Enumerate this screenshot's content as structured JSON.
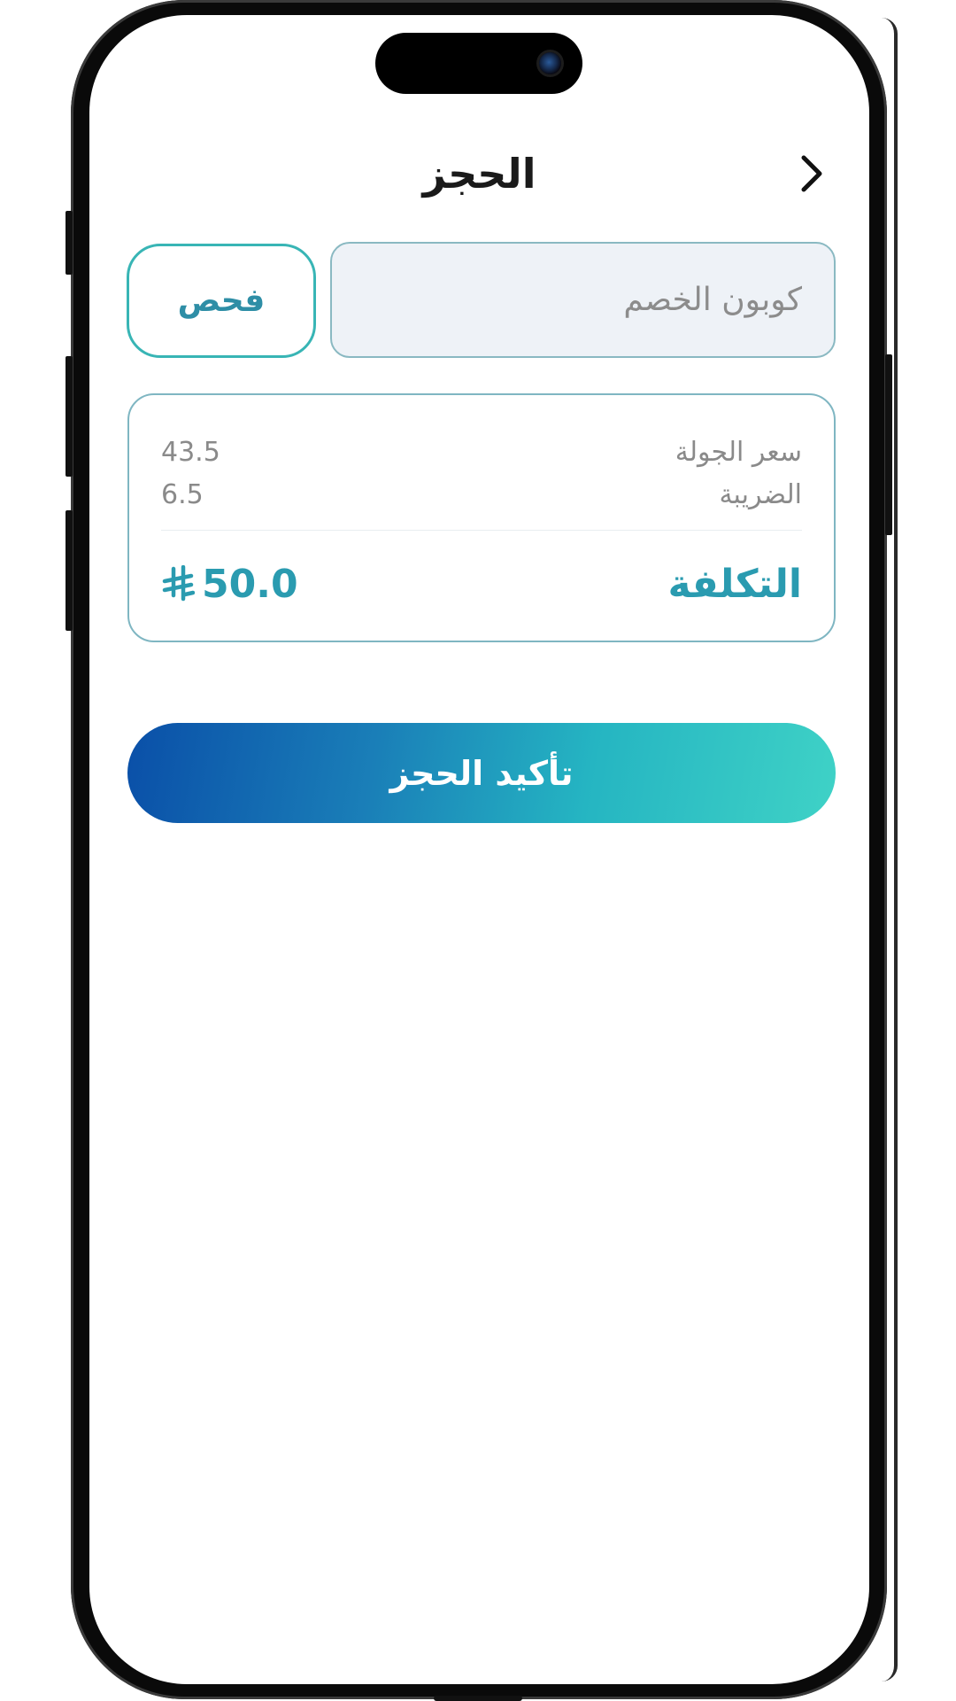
{
  "header": {
    "title": "الحجز"
  },
  "coupon": {
    "placeholder": "كوبون الخصم",
    "value": "",
    "check_label": "فحص"
  },
  "summary": {
    "rows": [
      {
        "label": "سعر الجولة",
        "value": "43.5"
      },
      {
        "label": "الضريبة",
        "value": "6.5"
      }
    ],
    "total_label": "التكلفة",
    "total_value": "50.0"
  },
  "confirm": {
    "label": "تأكيد الحجز"
  },
  "icons": {
    "back": "chevron-right-icon",
    "currency": "saudi-riyal-icon"
  },
  "colors": {
    "accent": "#2a9bb0",
    "gradient_start": "#0a4fa8",
    "gradient_end": "#3fd2c6",
    "input_bg": "#eef2f7"
  }
}
